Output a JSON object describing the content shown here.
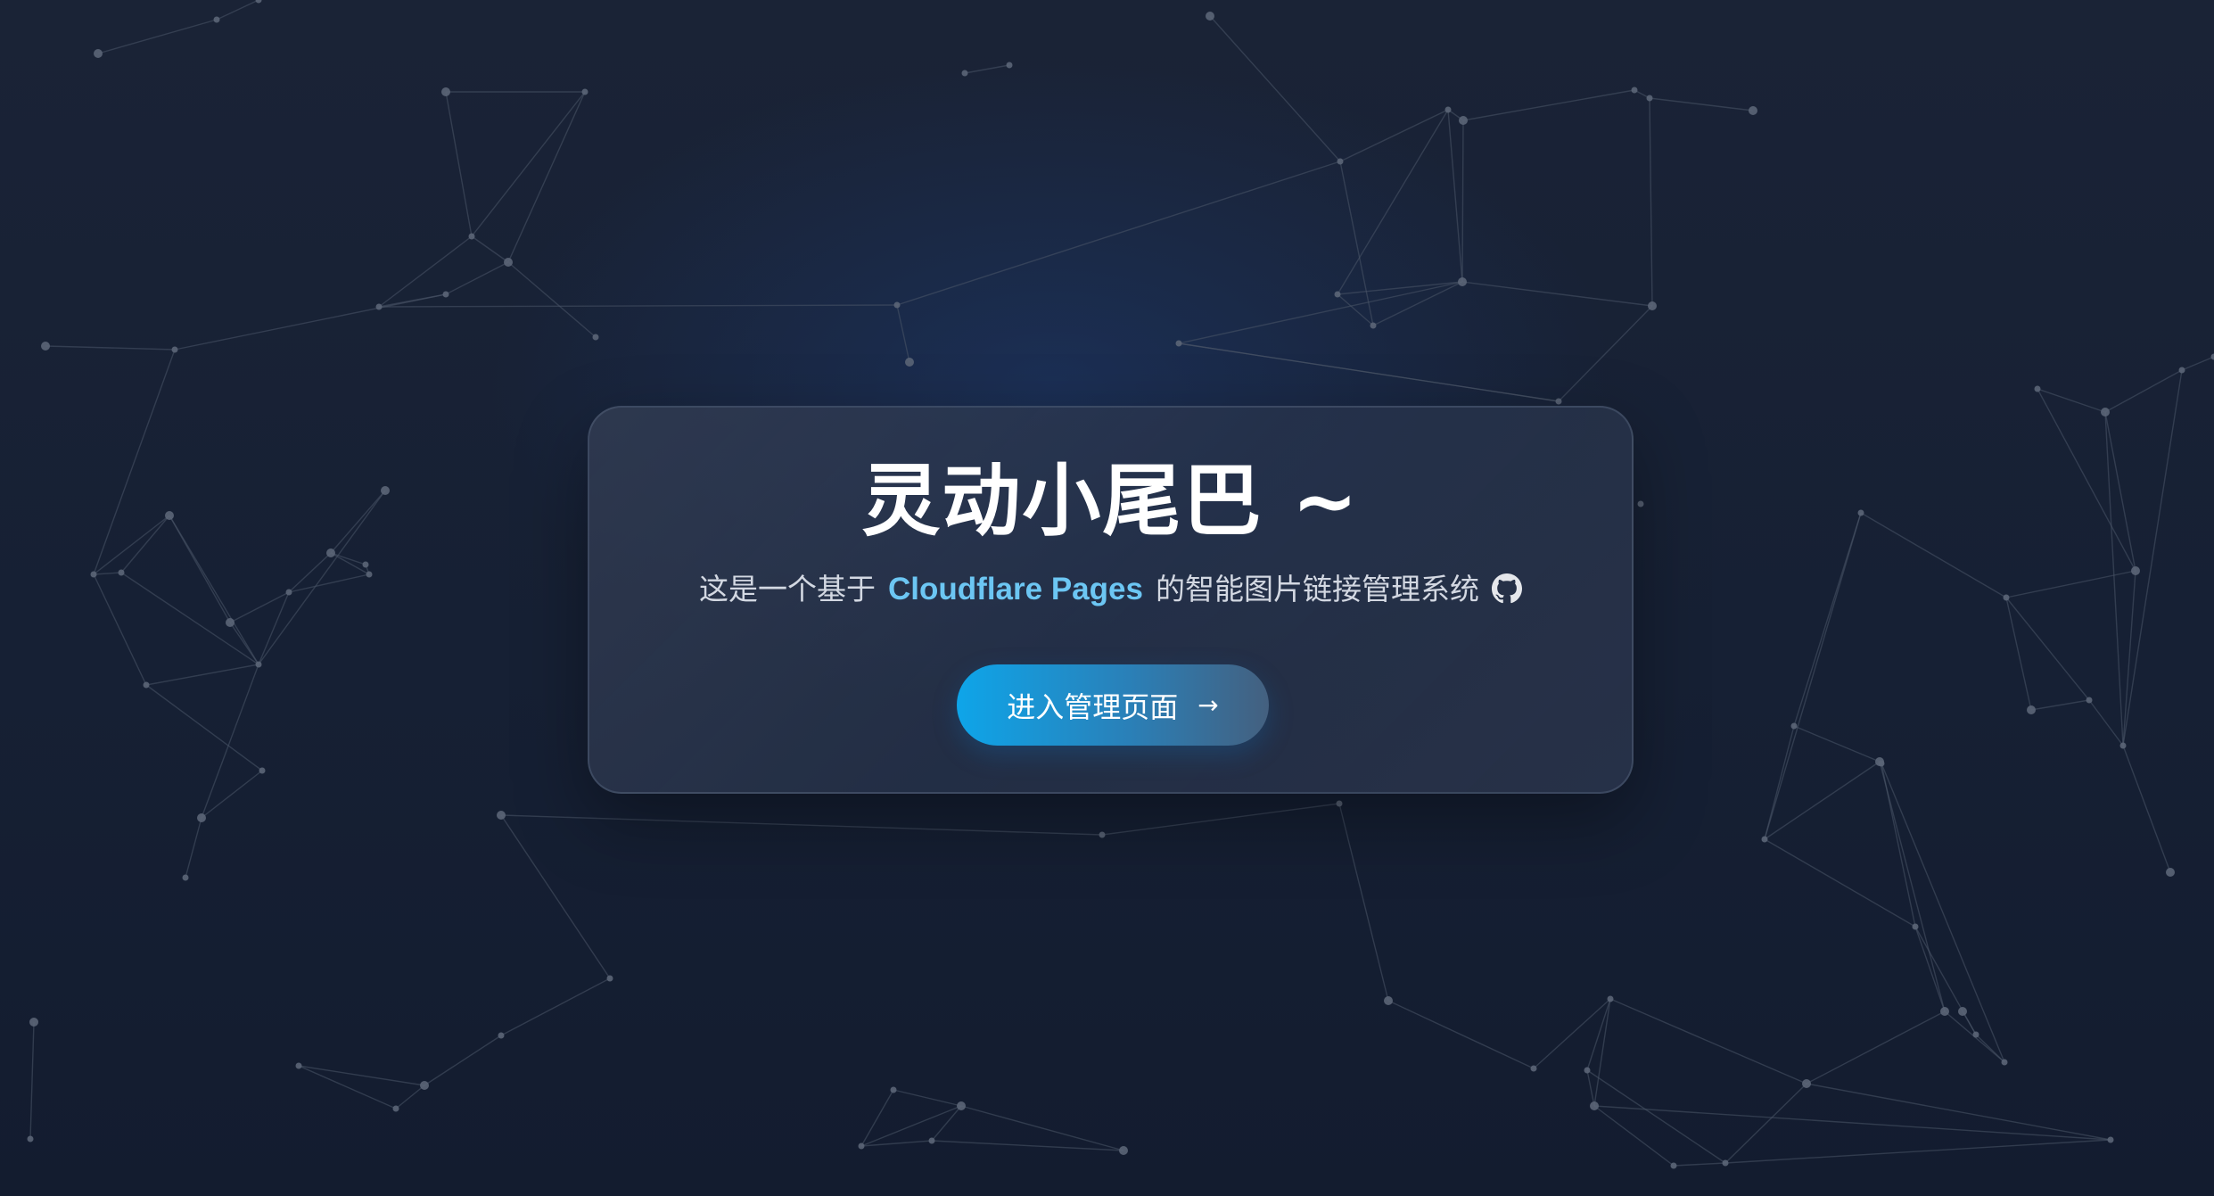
{
  "hero": {
    "title": "灵动小尾巴 ~",
    "subtitle_prefix": "这是一个基于",
    "subtitle_brand": "Cloudflare Pages",
    "subtitle_suffix": "的智能图片链接管理系统",
    "github_icon": "github-icon",
    "button_label": "进入管理页面",
    "button_icon": "arrow-right-icon"
  },
  "colors": {
    "background": "#161f33",
    "accent": "#0ea5e9",
    "brand_text": "#6cc6f3",
    "card_border": "#4b566b"
  }
}
